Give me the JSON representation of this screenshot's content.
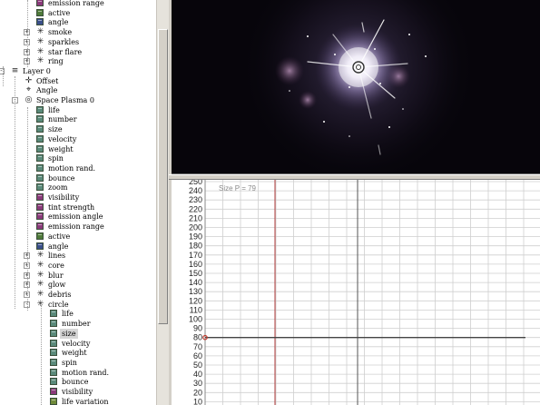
{
  "tree": {
    "rows": [
      {
        "label": "emission range",
        "indent": 40,
        "icon": "param",
        "color": "#8a3a7a"
      },
      {
        "label": "active",
        "indent": 40,
        "icon": "param",
        "color": "#4f7a3a"
      },
      {
        "label": "angle",
        "indent": 40,
        "icon": "param",
        "color": "#3a4f8a"
      },
      {
        "label": "smoke",
        "indent": 40,
        "icon": "emitter",
        "expander": "+"
      },
      {
        "label": "sparkles",
        "indent": 40,
        "icon": "emitter",
        "expander": "+"
      },
      {
        "label": "star flare",
        "indent": 40,
        "icon": "emitter",
        "expander": "+"
      },
      {
        "label": "ring",
        "indent": 40,
        "icon": "emitter",
        "expander": "+"
      },
      {
        "label": "Layer 0",
        "indent": 12,
        "icon": "layer",
        "expander": "-"
      },
      {
        "label": "Offset",
        "indent": 27,
        "icon": "offset"
      },
      {
        "label": "Angle",
        "indent": 27,
        "icon": "angle"
      },
      {
        "label": "Space Plasma 0",
        "indent": 27,
        "icon": "emitter-root",
        "expander": "-"
      },
      {
        "label": "life",
        "indent": 40,
        "icon": "param",
        "color": "#5a8a7a"
      },
      {
        "label": "number",
        "indent": 40,
        "icon": "param",
        "color": "#5a8a7a"
      },
      {
        "label": "size",
        "indent": 40,
        "icon": "param",
        "color": "#5a8a7a"
      },
      {
        "label": "velocity",
        "indent": 40,
        "icon": "param",
        "color": "#5a8a7a"
      },
      {
        "label": "weight",
        "indent": 40,
        "icon": "param",
        "color": "#5a8a7a"
      },
      {
        "label": "spin",
        "indent": 40,
        "icon": "param",
        "color": "#5a8a7a"
      },
      {
        "label": "motion rand.",
        "indent": 40,
        "icon": "param",
        "color": "#5a8a7a"
      },
      {
        "label": "bounce",
        "indent": 40,
        "icon": "param",
        "color": "#5a8a7a"
      },
      {
        "label": "zoom",
        "indent": 40,
        "icon": "param",
        "color": "#5a8a7a"
      },
      {
        "label": "visibility",
        "indent": 40,
        "icon": "param",
        "color": "#8a3a7a"
      },
      {
        "label": "tint strength",
        "indent": 40,
        "icon": "param",
        "color": "#8a3a7a"
      },
      {
        "label": "emission angle",
        "indent": 40,
        "icon": "param",
        "color": "#8a3a7a"
      },
      {
        "label": "emission range",
        "indent": 40,
        "icon": "param",
        "color": "#8a3a7a"
      },
      {
        "label": "active",
        "indent": 40,
        "icon": "param",
        "color": "#4f7a3a"
      },
      {
        "label": "angle",
        "indent": 40,
        "icon": "param",
        "color": "#3a4f8a"
      },
      {
        "label": "lines",
        "indent": 40,
        "icon": "emitter",
        "expander": "+"
      },
      {
        "label": "core",
        "indent": 40,
        "icon": "emitter",
        "expander": "+"
      },
      {
        "label": "blur",
        "indent": 40,
        "icon": "emitter",
        "expander": "+"
      },
      {
        "label": "glow",
        "indent": 40,
        "icon": "emitter",
        "expander": "+"
      },
      {
        "label": "debris",
        "indent": 40,
        "icon": "emitter",
        "expander": "+"
      },
      {
        "label": "circle",
        "indent": 40,
        "icon": "emitter",
        "expander": "-"
      },
      {
        "label": "life",
        "indent": 55,
        "icon": "param",
        "color": "#5a8a7a"
      },
      {
        "label": "number",
        "indent": 55,
        "icon": "param",
        "color": "#5a8a7a"
      },
      {
        "label": "size",
        "indent": 55,
        "icon": "param",
        "color": "#5a8a7a",
        "selected": true
      },
      {
        "label": "velocity",
        "indent": 55,
        "icon": "param",
        "color": "#5a8a7a"
      },
      {
        "label": "weight",
        "indent": 55,
        "icon": "param",
        "color": "#5a8a7a"
      },
      {
        "label": "spin",
        "indent": 55,
        "icon": "param",
        "color": "#5a8a7a"
      },
      {
        "label": "motion rand.",
        "indent": 55,
        "icon": "param",
        "color": "#5a8a7a"
      },
      {
        "label": "bounce",
        "indent": 55,
        "icon": "param",
        "color": "#5a8a7a"
      },
      {
        "label": "visibility",
        "indent": 55,
        "icon": "param",
        "color": "#8a3a7a"
      },
      {
        "label": "life variation",
        "indent": 55,
        "icon": "param",
        "color": "#6f8a3a"
      }
    ]
  },
  "graph": {
    "readout": "Size  P = 79",
    "y_ticks": [
      "250",
      "240",
      "230",
      "220",
      "210",
      "200",
      "190",
      "180",
      "170",
      "160",
      "150",
      "140",
      "130",
      "120",
      "110",
      "100",
      "90",
      "80",
      "70",
      "60",
      "50",
      "40",
      "30",
      "20",
      "10"
    ],
    "curve_value": 80,
    "marker_color": "#c0392b",
    "cursor_color": "#b03a3a",
    "grid_color": "#cfcfcf"
  },
  "preview": {
    "background": "#07050b",
    "glow_color": "#b8a8d8"
  }
}
